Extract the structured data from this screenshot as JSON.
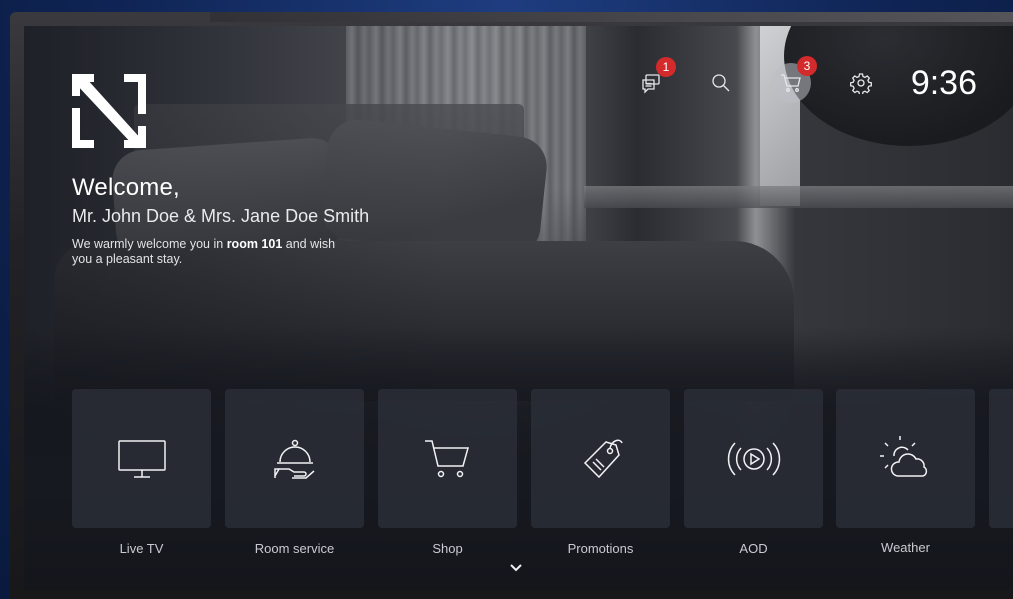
{
  "header": {
    "clock": "9:36",
    "messages_badge": "1",
    "cart_badge": "3",
    "icons": [
      "messages-icon",
      "search-icon",
      "cart-icon",
      "settings-icon"
    ]
  },
  "welcome": {
    "title": "Welcome,",
    "guest_names": "Mr. John Doe & Mrs. Jane Doe Smith",
    "message_before": "We warmly welcome you in ",
    "room": "room 101",
    "message_after": " and wish you a pleasant stay."
  },
  "tiles": [
    {
      "label": "Live TV",
      "icon": "tv-icon"
    },
    {
      "label": "Room service",
      "icon": "room-service-icon"
    },
    {
      "label": "Shop",
      "icon": "cart-icon"
    },
    {
      "label": "Promotions",
      "icon": "tag-icon"
    },
    {
      "label": "AOD",
      "icon": "audio-on-demand-icon"
    },
    {
      "label": "Weather",
      "icon": "weather-icon"
    }
  ],
  "colors": {
    "badge": "#d32b2b",
    "tile_bg": "#2c2f38",
    "text": "#ffffff",
    "frame_background": "#0f2454"
  }
}
